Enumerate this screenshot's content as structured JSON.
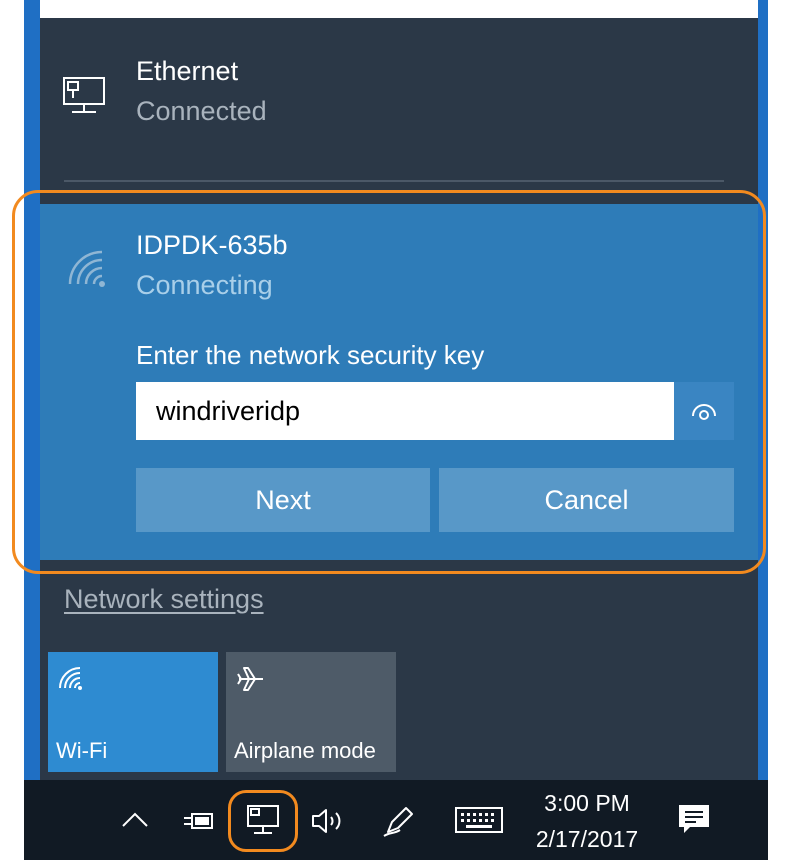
{
  "flyout": {
    "ethernet": {
      "title": "Ethernet",
      "status": "Connected"
    },
    "wifi_network": {
      "name": "IDPDK-635b",
      "status": "Connecting",
      "key_prompt": "Enter the network security key",
      "key_value": "windriveridp",
      "next_label": "Next",
      "cancel_label": "Cancel"
    },
    "network_settings_link": "Network settings",
    "quick_actions": [
      {
        "label": "Wi-Fi",
        "icon": "wifi-icon",
        "active": true
      },
      {
        "label": "Airplane mode",
        "icon": "airplane-icon",
        "active": false
      }
    ]
  },
  "taskbar": {
    "time": "3:00 PM",
    "date": "2/17/2017",
    "icons": [
      "chevron-up-icon",
      "power-icon",
      "network-icon",
      "volume-icon",
      "pen-icon",
      "keyboard-icon",
      "action-center-icon"
    ]
  },
  "colors": {
    "flyout_bg": "#2b3847",
    "wifi_card_bg": "#2e7cb8",
    "button_bg": "#5898c8",
    "highlight": "#f28a1f",
    "taskbar_bg": "#111a24",
    "wifi_tile_bg": "#2e8bd1",
    "airplane_tile_bg": "#4e5b68"
  }
}
